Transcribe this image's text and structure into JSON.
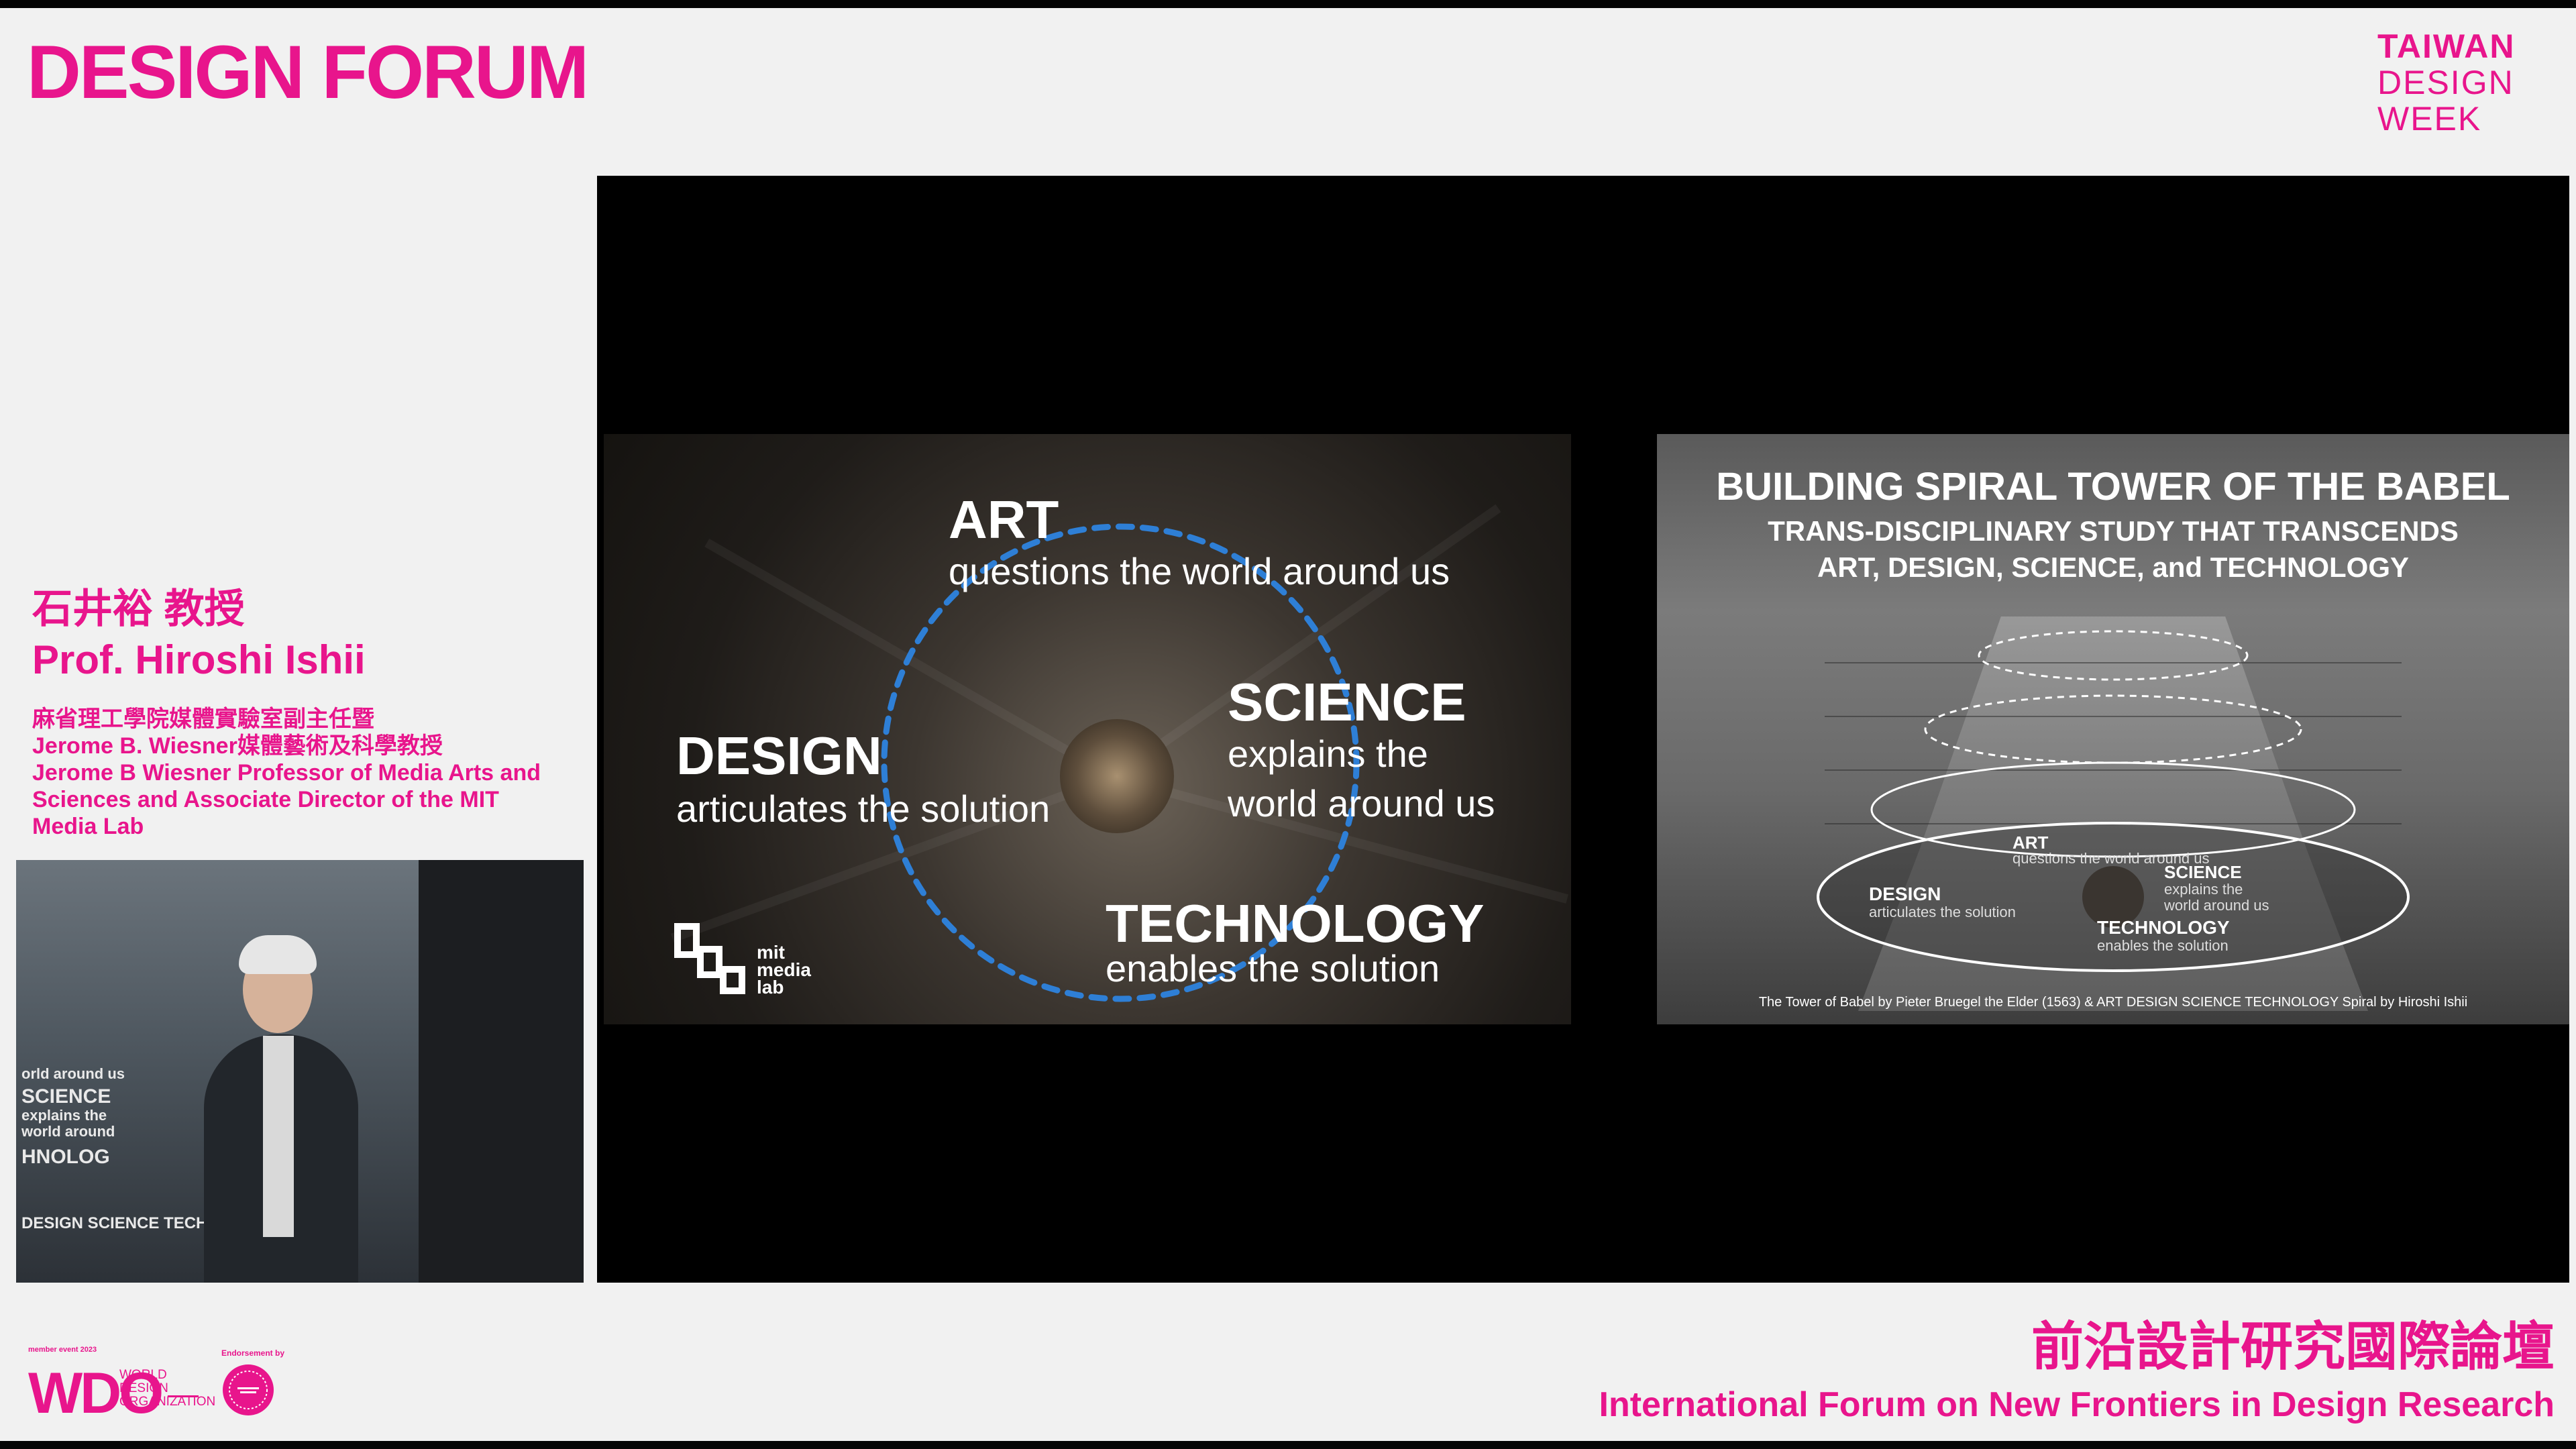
{
  "header": {
    "title": "DESIGN FORUM",
    "event_logo": [
      "TAIWAN",
      "DESIGN",
      "WEEK"
    ]
  },
  "speaker": {
    "name_zh": "石井裕 教授",
    "name_en": "Prof. Hiroshi Ishii",
    "affiliation": [
      "麻省理工學院媒體實驗室副主任暨",
      "Jerome B. Wiesner媒體藝術及科學教授",
      "Jerome B Wiesner Professor of Media Arts and",
      "Sciences and Associate Director of the MIT",
      "Media Lab"
    ],
    "video_overlay_text": [
      "orld around us",
      "SCIENCE",
      "explains the",
      "world around",
      "HNOLOG",
      "DESIGN SCIENCE TECHN"
    ]
  },
  "slide_left": {
    "art_title": "ART",
    "art_desc": "questions the world around us",
    "design_title": "DESIGN",
    "design_desc": "articulates the solution",
    "science_title": "SCIENCE",
    "science_desc_1": "explains the",
    "science_desc_2": "world around us",
    "technology_title": "TECHNOLOGY",
    "technology_desc": "enables the solution",
    "logo_text": [
      "mit",
      "media",
      "lab"
    ]
  },
  "slide_right": {
    "title": "BUILDING SPIRAL TOWER OF THE BABEL",
    "subtitle_1": "TRANS-DISCIPLINARY STUDY THAT TRANSCENDS",
    "subtitle_2": "ART, DESIGN, SCIENCE, and TECHNOLOGY",
    "labels": {
      "art": "ART",
      "art_desc": "questions the world around us",
      "design": "DESIGN",
      "design_desc": "articulates the solution",
      "science": "SCIENCE",
      "science_desc_1": "explains the",
      "science_desc_2": "world around us",
      "technology": "TECHNOLOGY",
      "technology_desc": "enables the solution"
    },
    "credit": "The Tower of Babel by Pieter Bruegel the Elder (1563)  & ART DESIGN SCIENCE TECHNOLOGY Spiral by Hiroshi Ishii"
  },
  "footer": {
    "wdo_small": "member event 2023",
    "wdo_mark": "WDO",
    "wdo_org": [
      "WORLD",
      "DESIGN",
      "ORGANIZATION"
    ],
    "endorsement_label": "Endorsement by",
    "forum_zh": "前沿設計研究國際論壇",
    "forum_en": "International Forum on New Frontiers in Design Research"
  },
  "colors": {
    "brand_pink": "#e8158c",
    "page_bg": "#f1f1f1",
    "stage_bg": "#000000",
    "dashed_circle": "#2e7fd6"
  }
}
